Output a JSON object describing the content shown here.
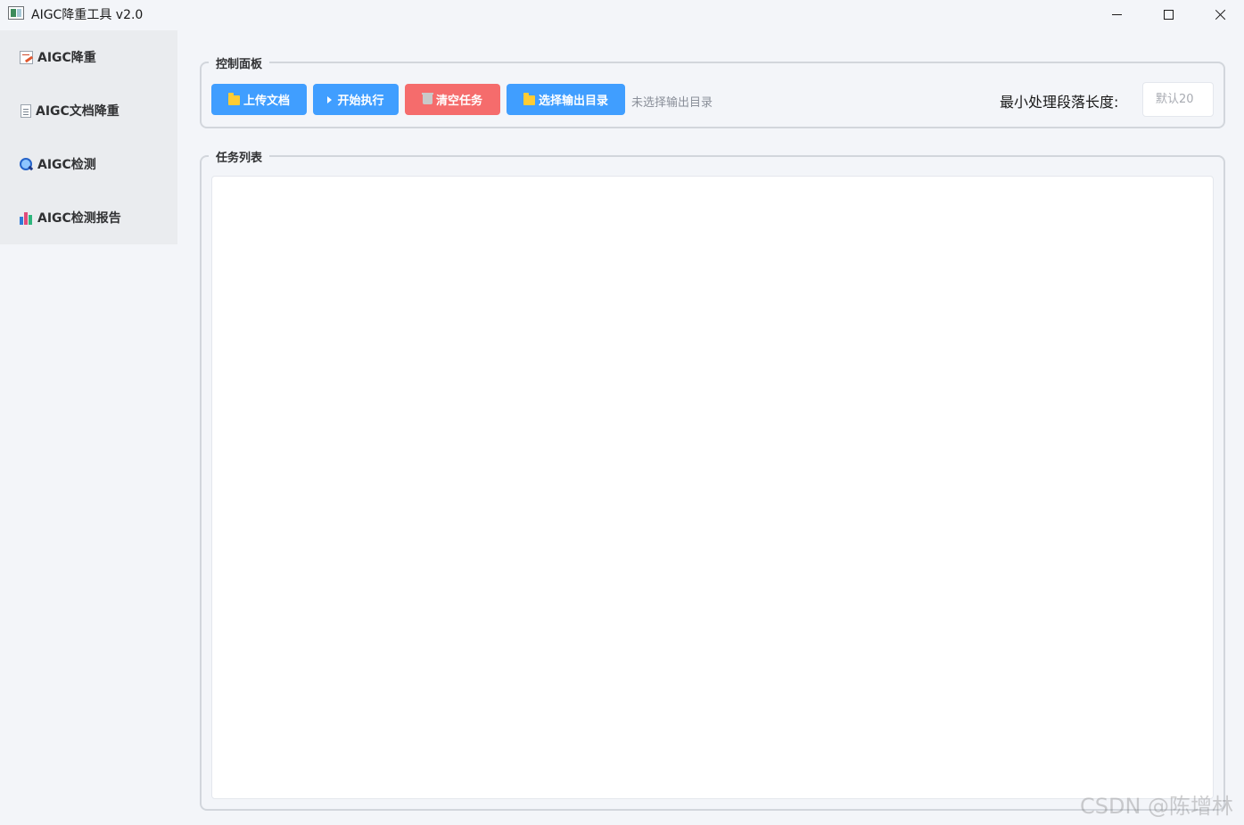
{
  "window": {
    "title": "AIGC降重工具 v2.0",
    "controls": {
      "minimize": "minimize",
      "maximize": "maximize",
      "close": "close"
    }
  },
  "sidebar": {
    "items": [
      {
        "label": "AIGC降重",
        "icon": "edit-icon"
      },
      {
        "label": "AIGC文档降重",
        "icon": "document-icon"
      },
      {
        "label": "AIGC检测",
        "icon": "search-icon"
      },
      {
        "label": "AIGC检测报告",
        "icon": "bar-chart-icon"
      }
    ]
  },
  "control_panel": {
    "title": "控制面板",
    "buttons": {
      "upload": "上传文档",
      "start": "开始执行",
      "clear": "清空任务",
      "select_output": "选择输出目录"
    },
    "output_dir_status": "未选择输出目录",
    "min_length_label": "最小处理段落长度:",
    "min_length_placeholder": "默认20",
    "min_length_value": ""
  },
  "task_list": {
    "title": "任务列表",
    "items": []
  },
  "watermark": "CSDN @陈增林",
  "colors": {
    "primary": "#409eff",
    "danger": "#f56c6c",
    "background": "#f3f5f9",
    "sidebar": "#eaecef"
  }
}
